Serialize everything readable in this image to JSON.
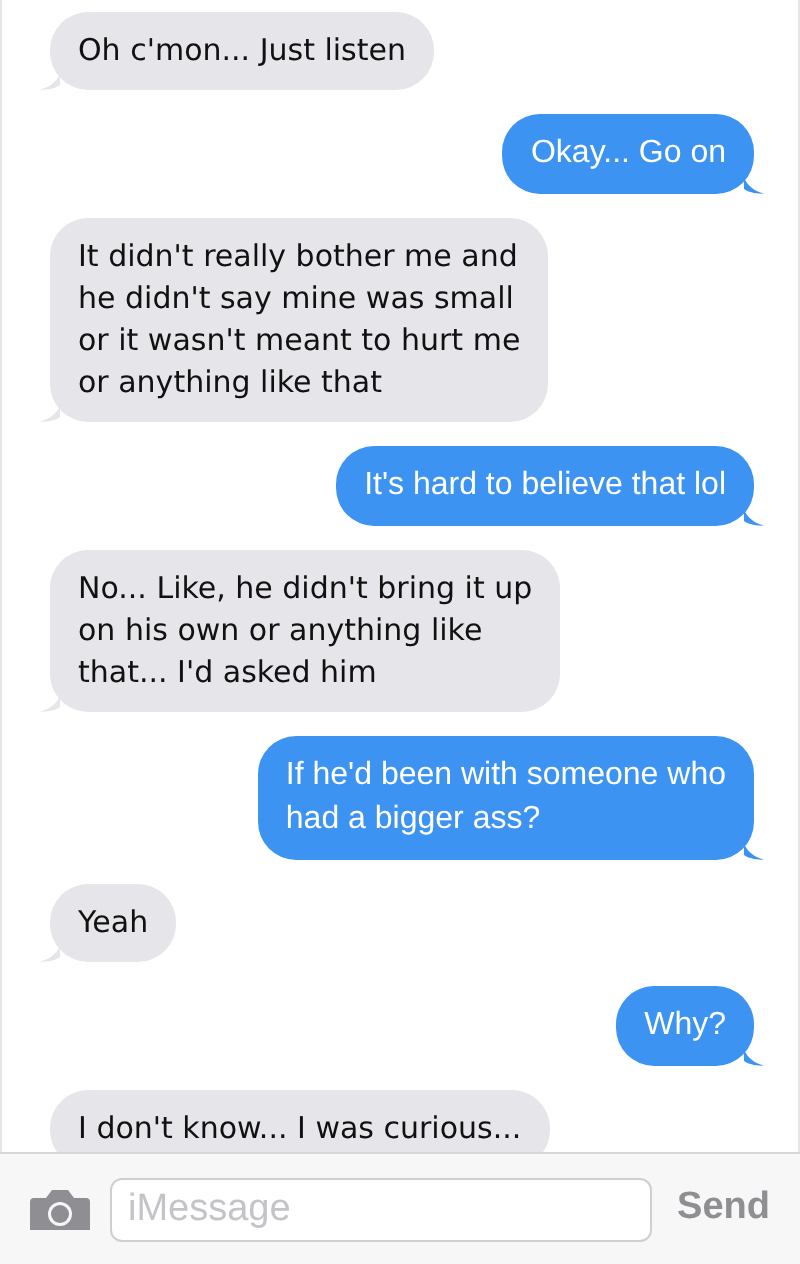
{
  "messages": [
    {
      "kind": "received",
      "tail": true,
      "text": "Oh c'mon... Just listen"
    },
    {
      "kind": "sent",
      "tail": true,
      "text": "Okay... Go on"
    },
    {
      "kind": "received",
      "tail": true,
      "text": "It didn't really bother me and\nhe didn't say mine was small\nor it wasn't meant to hurt me\nor anything like that"
    },
    {
      "kind": "sent",
      "tail": true,
      "text": "It's hard to believe that lol"
    },
    {
      "kind": "received",
      "tail": true,
      "text": "No... Like, he didn't bring it up\non his own or anything like\nthat... I'd asked him"
    },
    {
      "kind": "sent",
      "tail": true,
      "text": "If he'd been with someone who\nhad a bigger ass?"
    },
    {
      "kind": "received",
      "tail": true,
      "text": "Yeah"
    },
    {
      "kind": "sent",
      "tail": true,
      "text": "Why?"
    },
    {
      "kind": "received",
      "tail": false,
      "text": "I don't know... I was curious..."
    }
  ],
  "composer": {
    "placeholder": "iMessage",
    "send_button": {
      "label": "Send",
      "disabled": true
    }
  }
}
